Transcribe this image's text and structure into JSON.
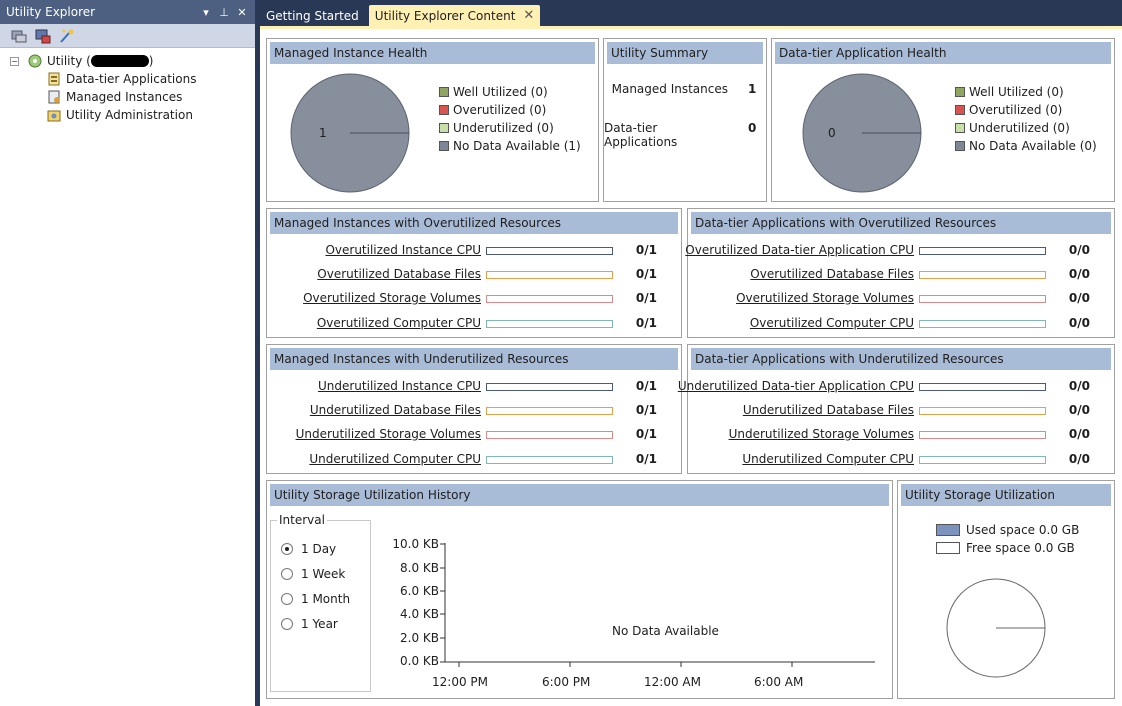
{
  "explorer": {
    "title": "Utility Explorer",
    "pin_glyph": "⬛",
    "tree": {
      "root_label": "Utility (",
      "root_label_end": ")",
      "children": [
        "Data-tier Applications",
        "Managed Instances",
        "Utility Administration"
      ]
    }
  },
  "tabs": [
    {
      "label": "Getting Started"
    },
    {
      "label": "Utility Explorer Content"
    }
  ],
  "managed_health": {
    "title": "Managed Instance Health",
    "pie_label": "1",
    "legend": [
      "Well Utilized (0)",
      "Overutilized (0)",
      "Underutilized (0)",
      "No Data Available (1)"
    ]
  },
  "summary": {
    "title": "Utility Summary",
    "managed_label": "Managed Instances",
    "managed_value": "1",
    "dta_label": "Data-tier Applications",
    "dta_value": "0"
  },
  "dta_health": {
    "title": "Data-tier Application Health",
    "pie_label": "0",
    "legend": [
      "Well Utilized (0)",
      "Overutilized (0)",
      "Underutilized (0)",
      "No Data Available (0)"
    ]
  },
  "colors": {
    "well": "#8ea661",
    "over": "#d9534f",
    "under": "#c8e0a8",
    "nodata": "#7f8696",
    "pie": "#878e9c",
    "header": "#a9bcd7",
    "bar_cpu": "#4a5a78",
    "bar_files": "#e0a24a",
    "bar_storage": "#d98a8a",
    "bar_computer": "#80b8b8"
  },
  "mi_over": {
    "title": "Managed Instances with Overutilized Resources",
    "rows": [
      {
        "label": "Overutilized Instance CPU",
        "value": "0/1"
      },
      {
        "label": "Overutilized Database Files",
        "value": "0/1"
      },
      {
        "label": "Overutilized Storage Volumes",
        "value": "0/1"
      },
      {
        "label": "Overutilized Computer CPU",
        "value": "0/1"
      }
    ]
  },
  "dta_over": {
    "title": "Data-tier Applications with Overutilized Resources",
    "rows": [
      {
        "label": "Overutilized Data-tier Application CPU",
        "value": "0/0"
      },
      {
        "label": "Overutilized Database Files",
        "value": "0/0"
      },
      {
        "label": "Overutilized Storage Volumes",
        "value": "0/0"
      },
      {
        "label": "Overutilized Computer CPU",
        "value": "0/0"
      }
    ]
  },
  "mi_under": {
    "title": "Managed Instances with Underutilized Resources",
    "rows": [
      {
        "label": "Underutilized Instance CPU",
        "value": "0/1"
      },
      {
        "label": "Underutilized Database Files",
        "value": "0/1"
      },
      {
        "label": "Underutilized Storage Volumes",
        "value": "0/1"
      },
      {
        "label": "Underutilized Computer CPU",
        "value": "0/1"
      }
    ]
  },
  "dta_under": {
    "title": "Data-tier Applications with Underutilized Resources",
    "rows": [
      {
        "label": "Underutilized Data-tier Application CPU",
        "value": "0/0"
      },
      {
        "label": "Underutilized Database Files",
        "value": "0/0"
      },
      {
        "label": "Underutilized Storage Volumes",
        "value": "0/0"
      },
      {
        "label": "Underutilized Computer CPU",
        "value": "0/0"
      }
    ]
  },
  "history": {
    "title": "Utility Storage Utilization History",
    "interval_label": "Interval",
    "intervals": [
      "1 Day",
      "1 Week",
      "1 Month",
      "1 Year"
    ],
    "selected_interval": "1 Day",
    "no_data": "No Data Available",
    "yticks": [
      "10.0 KB",
      "8.0 KB",
      "6.0 KB",
      "4.0 KB",
      "2.0 KB",
      "0.0 KB"
    ],
    "xticks": [
      "12:00 PM",
      "6:00 PM",
      "12:00 AM",
      "6:00 AM"
    ]
  },
  "storage": {
    "title": "Utility Storage Utilization",
    "used_label": "Used space 0.0 GB",
    "free_label": "Free space 0.0 GB",
    "used_color": "#7b93bd"
  }
}
